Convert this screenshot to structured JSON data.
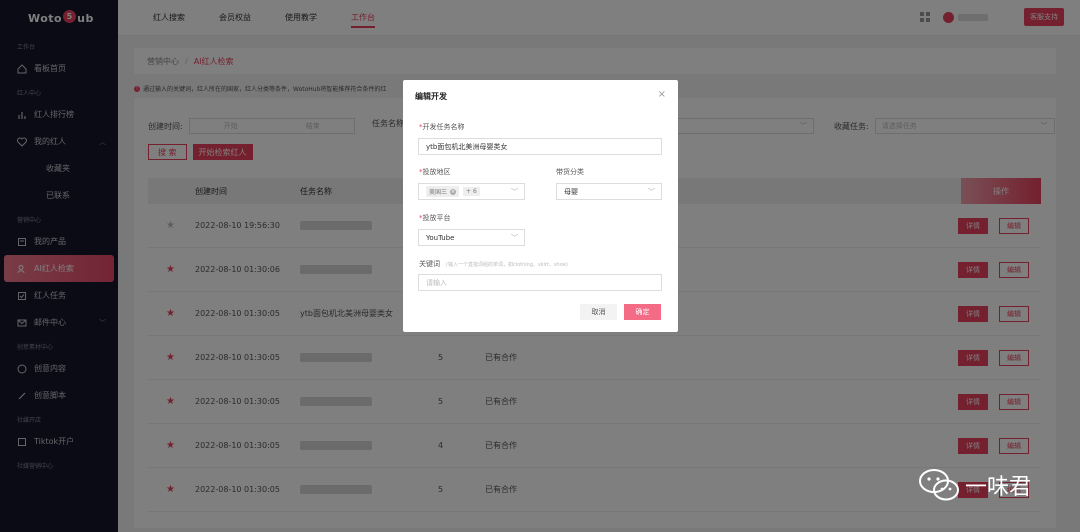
{
  "sidebar": {
    "logo": {
      "prefix": "Woto",
      "badge": "5",
      "suffix": "ub"
    },
    "sections": {
      "workbench": "工作台",
      "influencer_center": "红人中心",
      "marketing_center": "营销中心",
      "creative_center": "创意素材中心",
      "social_open": "社媒开店",
      "social_marketing": "社媒营销中心"
    },
    "items": {
      "dashboard": "看板首页",
      "ranking": "红人排行榜",
      "my_influencers": "我的红人",
      "favorites": "收藏夹",
      "contacted": "已联系",
      "my_products": "我的产品",
      "ai_search": "AI红人检索",
      "influencer_tasks": "红人任务",
      "mail_center": "邮件中心",
      "creative_content": "创意内容",
      "creative_script": "创意脚本",
      "tiktok_store": "Tiktok开户"
    }
  },
  "topbar": {
    "tabs": [
      "红人搜索",
      "会员权益",
      "使用教学",
      "工作台"
    ],
    "support": "客服支持"
  },
  "main": {
    "breadcrumb": {
      "root": "营销中心",
      "sep": "/",
      "current": "AI红人检索"
    },
    "notice": "通过输入的关键词，红人所在的国家，红人分类等条件，WotoHub将智能推荐符合条件的红",
    "filters": {
      "created_label": "创建时间:",
      "start_ph": "开始",
      "end_ph": "结束",
      "task_name_label": "任务名称",
      "favorite_label": "收藏任务:",
      "favorite_ph": "请选择任务",
      "search_btn": "搜 索",
      "start_btn": "开始检索红人"
    },
    "table": {
      "headers": {
        "time": "创建时间",
        "name": "任务名称",
        "op": "操作"
      },
      "detail": "详情",
      "edit": "编辑",
      "rows": [
        {
          "starred": false,
          "time": "2022-08-10 19:56:30",
          "name": "",
          "count": "",
          "status": ""
        },
        {
          "starred": true,
          "time": "2022-08-10 01:30:06",
          "name": "",
          "count": "",
          "status": ""
        },
        {
          "starred": true,
          "time": "2022-08-10 01:30:05",
          "name": "ytb面包机北美洲母婴类女",
          "count": "",
          "status": ""
        },
        {
          "starred": true,
          "time": "2022-08-10 01:30:05",
          "name": "",
          "count": "5",
          "status": "已有合作"
        },
        {
          "starred": true,
          "time": "2022-08-10 01:30:05",
          "name": "",
          "count": "5",
          "status": "已有合作"
        },
        {
          "starred": true,
          "time": "2022-08-10 01:30:05",
          "name": "",
          "count": "4",
          "status": "已有合作"
        },
        {
          "starred": true,
          "time": "2022-08-10 01:30:05",
          "name": "",
          "count": "5",
          "status": "已有合作"
        }
      ]
    }
  },
  "modal": {
    "title": "编辑开发",
    "close": "×",
    "task_name_label": "开发任务名称",
    "task_name_value": "ytb面包机北美洲母婴类女",
    "region_label": "投放地区",
    "region_tag": "美国三",
    "region_more": "+ 6",
    "category_label": "带货分类",
    "category_value": "母婴",
    "platform_label": "投放平台",
    "platform_value": "YouTube",
    "keyword_label": "关键词",
    "keyword_hint": "(输入一个直指词组的单词，如clothing、skirt、shoe)",
    "keyword_ph": "请输入",
    "cancel": "取消",
    "confirm": "确定"
  },
  "watermark": "一味君",
  "colors": {
    "accent": "#e8415c",
    "sidebar_bg": "#16162a",
    "confirm": "#f36b85"
  }
}
